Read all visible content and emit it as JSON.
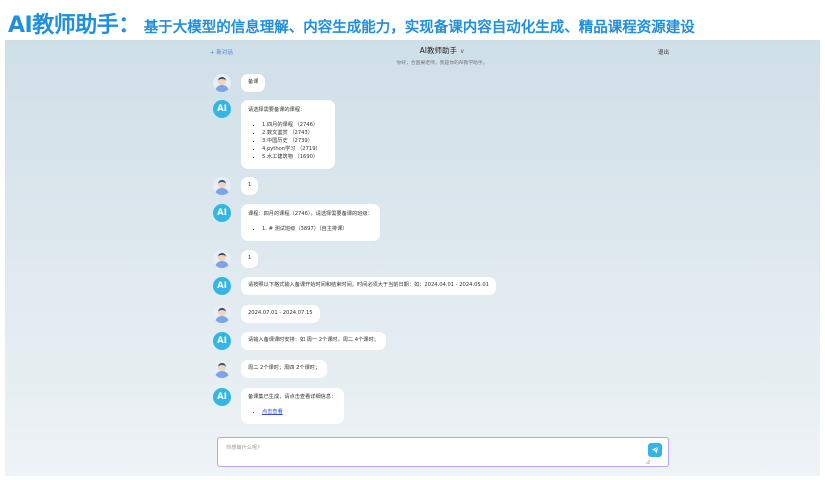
{
  "banner": {
    "title": "AI教师助手：",
    "subtitle": "基于大模型的信息理解、内容生成能力，实现备课内容自动化生成、精品课程资源建设"
  },
  "header": {
    "new_chat": "+ 新对话",
    "title": "AI教师助手",
    "title_chevron": "∨",
    "subtitle": "你好，合国果老师，我是你的AI教学助手。",
    "logout": "退出"
  },
  "avatar_ai_text": "AI",
  "messages": [
    {
      "role": "user",
      "text": "备课"
    },
    {
      "role": "ai",
      "text": "请选择需要备课的课程：",
      "items": [
        "1.四月的课程 （2746）",
        "2.数文鉴赏 （2743）",
        "3.中国历史 （2739）",
        "4.python学习 （2719）",
        "5.水工建筑物 （1690）"
      ]
    },
    {
      "role": "user",
      "text": "1"
    },
    {
      "role": "ai",
      "text": "课程：四月的课程（2746），请选择需要备课的班级：",
      "items": [
        "1. # 测试班级（3897）（自主排课）"
      ]
    },
    {
      "role": "user",
      "text": "1"
    },
    {
      "role": "ai",
      "text": "请按照以下格式输入备课开始时间和结束时间，时间必须大于当前日期：如：2024.04.01 - 2024.05.01"
    },
    {
      "role": "user",
      "text": "2024.07.01 - 2024.07.15"
    },
    {
      "role": "ai",
      "text": "请输入备课课时安排：如 周一 2个课时，周二 4个课时；"
    },
    {
      "role": "user",
      "text": "周二 2个课时；周四 2个课时；"
    },
    {
      "role": "ai",
      "text": "备课集已生成，请点击查看详细信息：",
      "link": "点击查看"
    }
  ],
  "composer": {
    "placeholder": "你想做什么呢?"
  },
  "colors": {
    "brand": "#1f8fe0",
    "ai_avatar": "#34b6e4",
    "send_button": "#35b5e6",
    "link": "#2b4fd6"
  },
  "icons": {
    "send": "paper-plane-icon",
    "user_avatar": "user-avatar-icon",
    "ai_avatar": "ai-avatar-icon"
  }
}
